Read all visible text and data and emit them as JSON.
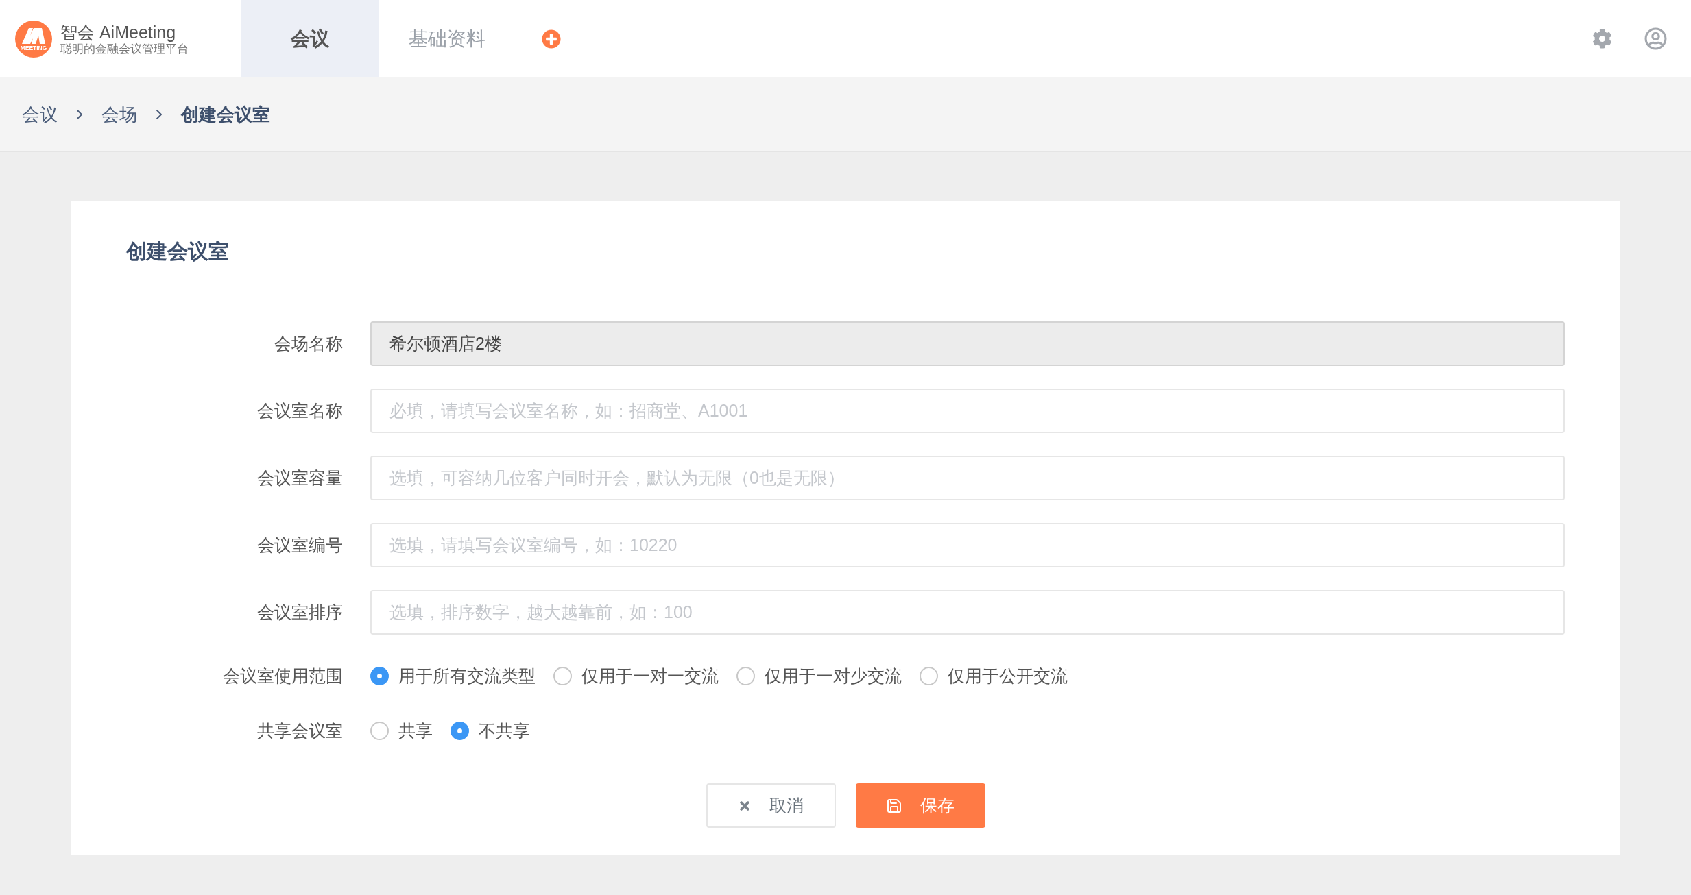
{
  "brand": {
    "name": "智会 AiMeeting",
    "tagline": "聪明的金融会议管理平台",
    "logo_text": "MEETING"
  },
  "nav_tabs": [
    {
      "label": "会议",
      "selected": true
    },
    {
      "label": "基础资料",
      "selected": false
    }
  ],
  "breadcrumb": [
    "会议",
    "会场",
    "创建会议室"
  ],
  "form": {
    "title": "创建会议室",
    "fields": [
      {
        "label": "会场名称",
        "kind": "readonly",
        "value": "希尔顿酒店2楼"
      },
      {
        "label": "会议室名称",
        "kind": "input",
        "placeholder": "必填，请填写会议室名称，如：招商堂、A1001"
      },
      {
        "label": "会议室容量",
        "kind": "input",
        "placeholder": "选填，可容纳几位客户同时开会，默认为无限（0也是无限）"
      },
      {
        "label": "会议室编号",
        "kind": "input",
        "placeholder": "选填，请填写会议室编号，如：10220"
      },
      {
        "label": "会议室排序",
        "kind": "input",
        "placeholder": "选填，排序数字，越大越靠前，如：100"
      }
    ],
    "radio_groups": [
      {
        "label": "会议室使用范围",
        "options": [
          {
            "label": "用于所有交流类型",
            "selected": true
          },
          {
            "label": "仅用于一对一交流",
            "selected": false
          },
          {
            "label": "仅用于一对少交流",
            "selected": false
          },
          {
            "label": "仅用于公开交流",
            "selected": false
          }
        ]
      },
      {
        "label": "共享会议室",
        "options": [
          {
            "label": "共享",
            "selected": false
          },
          {
            "label": "不共享",
            "selected": true
          }
        ]
      }
    ],
    "cancel_button": "取消",
    "save_button": "保存"
  }
}
